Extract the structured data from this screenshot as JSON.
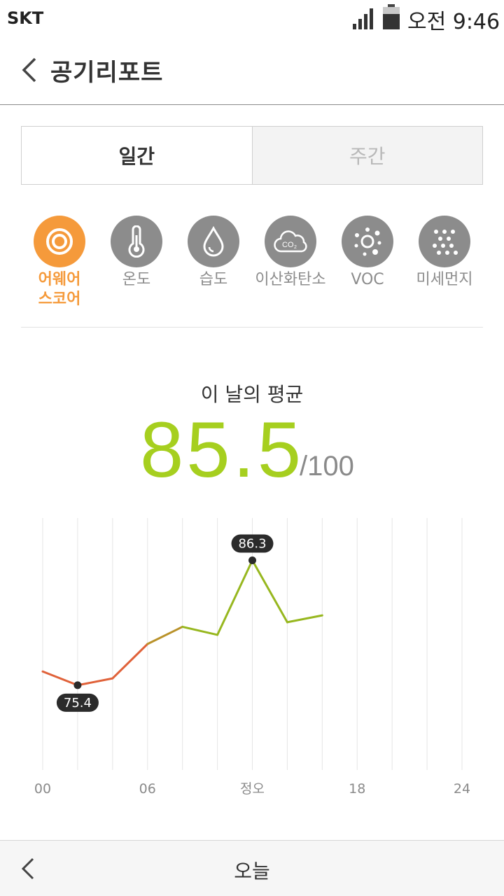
{
  "status_bar": {
    "carrier": "SKT",
    "time": "오전 9:46"
  },
  "header": {
    "title": "공기리포트",
    "back_icon": "chevron-left-icon"
  },
  "tabs": [
    {
      "label": "일간",
      "selected": true
    },
    {
      "label": "주간",
      "selected": false
    }
  ],
  "metrics": [
    {
      "label": "어웨어\n스코어",
      "icon": "target-ring-icon",
      "selected": true
    },
    {
      "label": "온도",
      "icon": "thermometer-icon",
      "selected": false
    },
    {
      "label": "습도",
      "icon": "water-drop-icon",
      "selected": false
    },
    {
      "label": "이산화탄소",
      "icon": "co2-cloud-icon",
      "selected": false
    },
    {
      "label": "VOC",
      "icon": "voc-molecules-icon",
      "selected": false
    },
    {
      "label": "미세먼지",
      "icon": "dust-dots-icon",
      "selected": false
    }
  ],
  "average": {
    "label": "이 날의 평균",
    "value": "85.5",
    "max": "/100"
  },
  "colors": {
    "accent": "#f59a3b",
    "score_green": "#a6cf1f",
    "line_low": "#e0623a",
    "line_high": "#97b71f",
    "icon_gray": "#8c8c8c"
  },
  "chart_data": {
    "type": "line",
    "x_tick_labels": [
      "00",
      "06",
      "정오",
      "18",
      "24"
    ],
    "x_ticks": [
      0,
      6,
      12,
      18,
      24
    ],
    "xlim": [
      0,
      24
    ],
    "ylim": [
      68,
      90
    ],
    "series": [
      {
        "x": [
          0,
          2,
          4,
          6,
          8,
          10,
          12,
          14,
          16
        ],
        "values": [
          76.6,
          75.4,
          76.0,
          79.0,
          80.5,
          79.8,
          86.3,
          80.9,
          81.5
        ]
      }
    ],
    "annotations": [
      {
        "x": 2,
        "value": 75.4,
        "label": "75.4",
        "position": "below"
      },
      {
        "x": 12,
        "value": 86.3,
        "label": "86.3",
        "position": "above"
      }
    ],
    "grid": true
  },
  "bottom_bar": {
    "label": "오늘",
    "back_icon": "chevron-left-icon"
  }
}
